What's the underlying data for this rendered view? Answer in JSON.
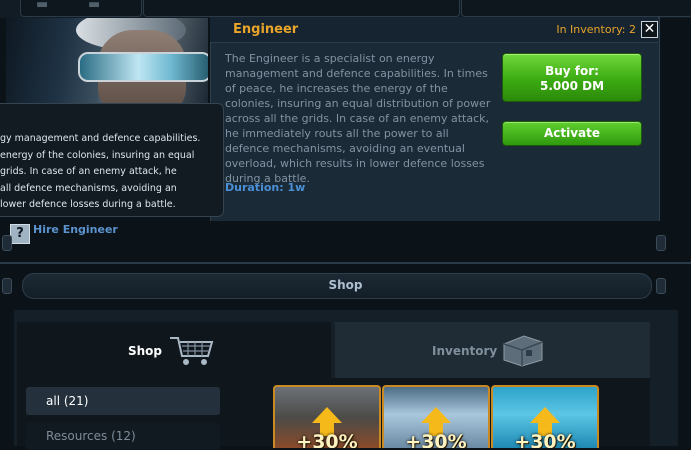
{
  "detail": {
    "title": "Engineer",
    "inventory_label": "In Inventory: 2",
    "close_symbol": "✕",
    "description": "The Engineer is a specialist on energy management and defence capabilities. In times of peace, he increases the energy of the colonies, insuring an equal distribution of power across all the grids. In case of an enemy attack, he immediately routs all the power to all defence mechanisms, avoiding an eventual overload, which results in lower defence losses during a battle.",
    "duration": "Duration: 1w",
    "buy_line1": "Buy for:",
    "buy_line2": "5.000 DM",
    "activate": "Activate"
  },
  "tooltip": {
    "lines": [
      "gy management and defence capabilities.",
      "energy of the colonies, insuring an equal",
      "grids. In case of an enemy attack, he",
      "all defence mechanisms, avoiding an",
      "lower defence losses during a battle."
    ]
  },
  "hire": {
    "help_symbol": "?",
    "link": "Hire Engineer"
  },
  "shop": {
    "header": "Shop",
    "tabs": [
      {
        "label": "Shop",
        "icon": "shopping-cart-icon",
        "active": true
      },
      {
        "label": "Inventory",
        "icon": "inventory-box-icon",
        "active": false
      }
    ],
    "categories": [
      {
        "label": "all (21)",
        "active": true
      },
      {
        "label": "Resources (12)",
        "active": false
      }
    ],
    "items": [
      {
        "name": "metal-booster",
        "badge": "+30%"
      },
      {
        "name": "crystal-booster",
        "badge": "+30%"
      },
      {
        "name": "deuterium-booster",
        "badge": "+30%"
      }
    ]
  },
  "colors": {
    "accent_orange": "#e8a52a",
    "button_green": "#3bab12",
    "link_blue": "#5b93cf",
    "card_border": "#c98a24"
  }
}
